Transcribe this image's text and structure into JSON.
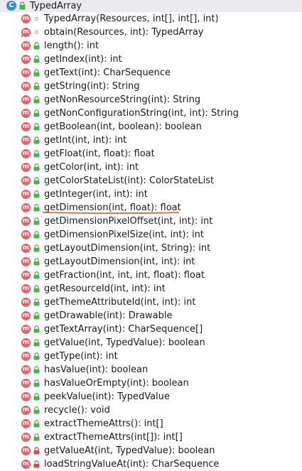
{
  "class": {
    "icon": "class-icon",
    "letter": "C",
    "title": "TypedArray"
  },
  "method_letter": "m",
  "members": [
    {
      "label": "TypedArray(Resources, int[], int[], int)",
      "kind": "constructor",
      "visibility": "package"
    },
    {
      "label": "obtain(Resources, int): TypedArray",
      "kind": "static",
      "visibility": "package"
    },
    {
      "label": "length(): int",
      "kind": "method",
      "visibility": "public"
    },
    {
      "label": "getIndex(int): int",
      "kind": "method",
      "visibility": "public"
    },
    {
      "label": "getText(int): CharSequence",
      "kind": "method",
      "visibility": "public"
    },
    {
      "label": "getString(int): String",
      "kind": "method",
      "visibility": "public"
    },
    {
      "label": "getNonResourceString(int): String",
      "kind": "method",
      "visibility": "public"
    },
    {
      "label": "getNonConfigurationString(int, int): String",
      "kind": "method",
      "visibility": "public"
    },
    {
      "label": "getBoolean(int, boolean): boolean",
      "kind": "method",
      "visibility": "public"
    },
    {
      "label": "getInt(int, int): int",
      "kind": "method",
      "visibility": "public"
    },
    {
      "label": "getFloat(int, float): float",
      "kind": "method",
      "visibility": "public"
    },
    {
      "label": "getColor(int, int): int",
      "kind": "method",
      "visibility": "public"
    },
    {
      "label": "getColorStateList(int): ColorStateList",
      "kind": "method",
      "visibility": "public"
    },
    {
      "label": "getInteger(int, int): int",
      "kind": "method",
      "visibility": "public"
    },
    {
      "label": "getDimension(int, float): float",
      "kind": "method",
      "visibility": "public",
      "highlighted": true
    },
    {
      "label": "getDimensionPixelOffset(int, int): int",
      "kind": "method",
      "visibility": "public"
    },
    {
      "label": "getDimensionPixelSize(int, int): int",
      "kind": "method",
      "visibility": "public"
    },
    {
      "label": "getLayoutDimension(int, String): int",
      "kind": "method",
      "visibility": "public"
    },
    {
      "label": "getLayoutDimension(int, int): int",
      "kind": "method",
      "visibility": "public"
    },
    {
      "label": "getFraction(int, int, int, float): float",
      "kind": "method",
      "visibility": "public"
    },
    {
      "label": "getResourceId(int, int): int",
      "kind": "method",
      "visibility": "public"
    },
    {
      "label": "getThemeAttributeId(int, int): int",
      "kind": "method",
      "visibility": "public"
    },
    {
      "label": "getDrawable(int): Drawable",
      "kind": "method",
      "visibility": "public"
    },
    {
      "label": "getTextArray(int): CharSequence[]",
      "kind": "method",
      "visibility": "public"
    },
    {
      "label": "getValue(int, TypedValue): boolean",
      "kind": "method",
      "visibility": "public"
    },
    {
      "label": "getType(int): int",
      "kind": "method",
      "visibility": "public"
    },
    {
      "label": "hasValue(int): boolean",
      "kind": "method",
      "visibility": "public"
    },
    {
      "label": "hasValueOrEmpty(int): boolean",
      "kind": "method",
      "visibility": "public"
    },
    {
      "label": "peekValue(int): TypedValue",
      "kind": "method",
      "visibility": "public"
    },
    {
      "label": "recycle(): void",
      "kind": "method",
      "visibility": "public"
    },
    {
      "label": "extractThemeAttrs(): int[]",
      "kind": "method",
      "visibility": "public"
    },
    {
      "label": "extractThemeAttrs(int[]): int[]",
      "kind": "method",
      "visibility": "public"
    },
    {
      "label": "getValueAt(int, TypedValue): boolean",
      "kind": "method",
      "visibility": "private"
    },
    {
      "label": "loadStringValueAt(int): CharSequence",
      "kind": "method",
      "visibility": "private"
    }
  ],
  "colors": {
    "method_badge": "#e5626b",
    "class_badge": "#3a8bd6",
    "public_lock": "#4caf50",
    "private_lock": "#d84a4a",
    "package_dot": "#9aa0a6",
    "highlight_underline": "#e8632b",
    "header_bg": "#e9ebee"
  }
}
